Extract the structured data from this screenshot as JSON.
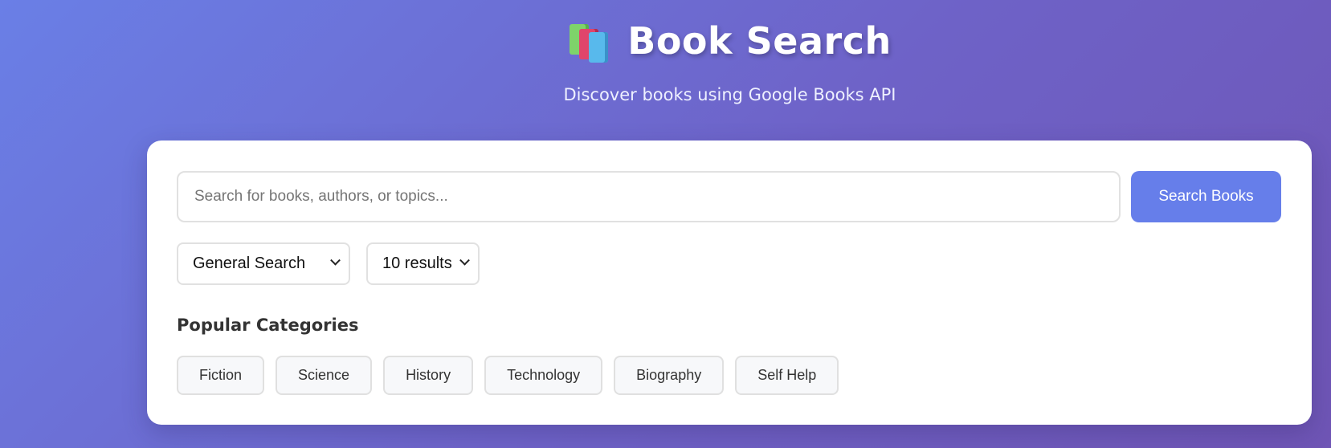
{
  "header": {
    "icon": "books-icon",
    "title": "Book Search",
    "subtitle": "Discover books using Google Books API"
  },
  "search": {
    "placeholder": "Search for books, authors, or topics...",
    "value": "",
    "button_label": "Search Books"
  },
  "filters": {
    "search_type": "General Search",
    "results_count": "10 results"
  },
  "categories": {
    "heading": "Popular Categories",
    "items": [
      {
        "label": "Fiction"
      },
      {
        "label": "Science"
      },
      {
        "label": "History"
      },
      {
        "label": "Technology"
      },
      {
        "label": "Biography"
      },
      {
        "label": "Self Help"
      }
    ]
  },
  "colors": {
    "accent": "#667eea",
    "background_start": "#6a7fe6",
    "background_end": "#6f55b5"
  }
}
